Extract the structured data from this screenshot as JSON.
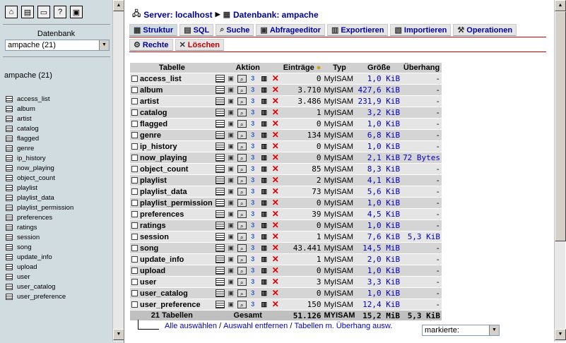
{
  "sidebar": {
    "icons": [
      "home-icon",
      "sql-query-icon",
      "sql-window-icon",
      "documentation-icon",
      "help-icon"
    ],
    "database_label": "Datenbank",
    "database_selected": "ampache (21)",
    "database_name": "ampache (21)",
    "tables": [
      "access_list",
      "album",
      "artist",
      "catalog",
      "flagged",
      "genre",
      "ip_history",
      "now_playing",
      "object_count",
      "playlist",
      "playlist_data",
      "playlist_permission",
      "preferences",
      "ratings",
      "session",
      "song",
      "update_info",
      "upload",
      "user",
      "user_catalog",
      "user_preference"
    ]
  },
  "breadcrumb": {
    "server": "Server: localhost",
    "database": "Datenbank: ampache"
  },
  "tabs": [
    {
      "label": "Struktur",
      "icon": "structure-icon",
      "active": true
    },
    {
      "label": "SQL",
      "icon": "sql-icon"
    },
    {
      "label": "Suche",
      "icon": "search-icon"
    },
    {
      "label": "Abfrageeditor",
      "icon": "query-editor-icon"
    },
    {
      "label": "Exportieren",
      "icon": "export-icon"
    },
    {
      "label": "Importieren",
      "icon": "import-icon"
    },
    {
      "label": "Operationen",
      "icon": "operations-icon"
    }
  ],
  "tabs2": [
    {
      "label": "Rechte",
      "icon": "privileges-icon"
    },
    {
      "label": "Löschen",
      "icon": "drop-icon"
    }
  ],
  "table": {
    "headers": {
      "table": "Tabelle",
      "action": "Aktion",
      "entries": "Einträge",
      "type": "Typ",
      "size": "Größe",
      "overhead": "Überhang"
    },
    "rows": [
      {
        "name": "access_list",
        "entries": "0",
        "type": "MyISAM",
        "size": "1,0 KiB",
        "overhead": "-"
      },
      {
        "name": "album",
        "entries": "3.710",
        "type": "MyISAM",
        "size": "427,6 KiB",
        "overhead": "-"
      },
      {
        "name": "artist",
        "entries": "3.486",
        "type": "MyISAM",
        "size": "231,9 KiB",
        "overhead": "-"
      },
      {
        "name": "catalog",
        "entries": "1",
        "type": "MyISAM",
        "size": "3,2 KiB",
        "overhead": "-"
      },
      {
        "name": "flagged",
        "entries": "0",
        "type": "MyISAM",
        "size": "1,0 KiB",
        "overhead": "-"
      },
      {
        "name": "genre",
        "entries": "134",
        "type": "MyISAM",
        "size": "6,8 KiB",
        "overhead": "-"
      },
      {
        "name": "ip_history",
        "entries": "0",
        "type": "MyISAM",
        "size": "1,0 KiB",
        "overhead": "-"
      },
      {
        "name": "now_playing",
        "entries": "0",
        "type": "MyISAM",
        "size": "2,1 KiB",
        "overhead": "72 Bytes"
      },
      {
        "name": "object_count",
        "entries": "85",
        "type": "MyISAM",
        "size": "8,3 KiB",
        "overhead": "-"
      },
      {
        "name": "playlist",
        "entries": "2",
        "type": "MyISAM",
        "size": "4,1 KiB",
        "overhead": "-"
      },
      {
        "name": "playlist_data",
        "entries": "73",
        "type": "MyISAM",
        "size": "5,6 KiB",
        "overhead": "-"
      },
      {
        "name": "playlist_permission",
        "entries": "0",
        "type": "MyISAM",
        "size": "1,0 KiB",
        "overhead": "-"
      },
      {
        "name": "preferences",
        "entries": "39",
        "type": "MyISAM",
        "size": "4,5 KiB",
        "overhead": "-"
      },
      {
        "name": "ratings",
        "entries": "0",
        "type": "MyISAM",
        "size": "1,0 KiB",
        "overhead": "-"
      },
      {
        "name": "session",
        "entries": "1",
        "type": "MyISAM",
        "size": "7,6 KiB",
        "overhead": "5,3 KiB"
      },
      {
        "name": "song",
        "entries": "43.441",
        "type": "MyISAM",
        "size": "14,5 MiB",
        "overhead": "-"
      },
      {
        "name": "update_info",
        "entries": "1",
        "type": "MyISAM",
        "size": "2,0 KiB",
        "overhead": "-"
      },
      {
        "name": "upload",
        "entries": "0",
        "type": "MyISAM",
        "size": "1,0 KiB",
        "overhead": "-"
      },
      {
        "name": "user",
        "entries": "3",
        "type": "MyISAM",
        "size": "3,3 KiB",
        "overhead": "-"
      },
      {
        "name": "user_catalog",
        "entries": "0",
        "type": "MyISAM",
        "size": "1,0 KiB",
        "overhead": "-"
      },
      {
        "name": "user_preference",
        "entries": "150",
        "type": "MyISAM",
        "size": "12,4 KiB",
        "overhead": "-"
      }
    ],
    "footer": {
      "count": "21 Tabellen",
      "total_label": "Gesamt",
      "entries": "51.126",
      "type": "MYISAM",
      "size": "15,2 MiB",
      "overhead": "5,3 KiB"
    }
  },
  "bottom": {
    "select_all": "Alle auswählen",
    "deselect": "Auswahl entfernen",
    "overhead_select": "Tabellen m. Überhang ausw.",
    "separator": " / ",
    "with_selected": "markierte:"
  }
}
